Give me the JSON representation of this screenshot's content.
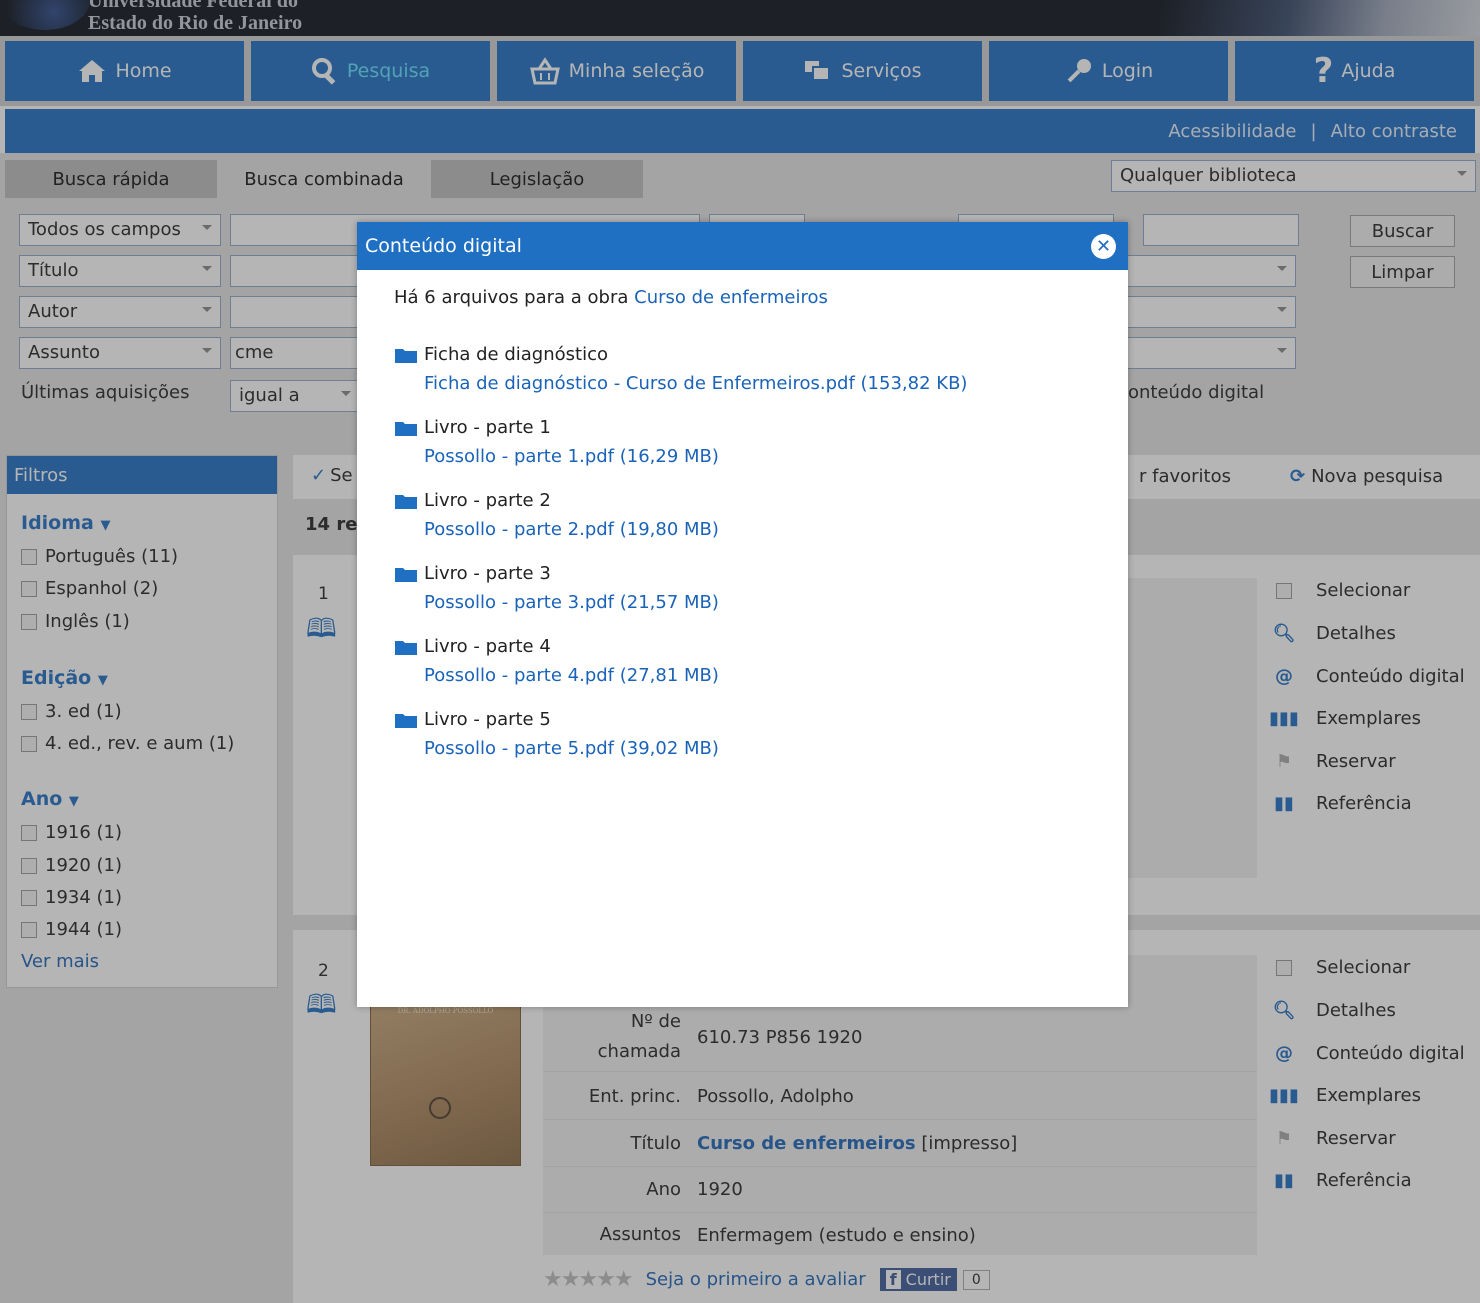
{
  "header": {
    "line1": "Universidade Federal do",
    "line2": "Estado do Rio de Janeiro"
  },
  "nav": [
    {
      "label": "Home",
      "icon": "home-icon"
    },
    {
      "label": "Pesquisa",
      "icon": "search-icon"
    },
    {
      "label": "Minha seleção",
      "icon": "basket-icon"
    },
    {
      "label": "Serviços",
      "icon": "windows-icon"
    },
    {
      "label": "Login",
      "icon": "key-icon"
    },
    {
      "label": "Ajuda",
      "icon": "help-icon"
    }
  ],
  "bluebar": {
    "accessibility": "Acessibilidade",
    "separator": "|",
    "contrast": "Alto contraste"
  },
  "tabs": [
    "Busca rápida",
    "Busca combinada",
    "Legislação"
  ],
  "library_select": "Qualquer biblioteca",
  "search": {
    "fields": [
      "Todos os campos",
      "Título",
      "Autor",
      "Assunto"
    ],
    "assunto_value": "cme",
    "last_label": "Últimas aquisições",
    "last_op": "igual a",
    "digital_label": "onteúdo digital",
    "buscar": "Buscar",
    "limpar": "Limpar"
  },
  "filters": {
    "title": "Filtros",
    "idioma": "Idioma",
    "idioma_items": [
      "Português (11)",
      "Espanhol (2)",
      "Inglês (1)"
    ],
    "edicao": "Edição",
    "edicao_items": [
      "3. ed (1)",
      "4. ed., rev. e aum (1)"
    ],
    "ano": "Ano",
    "ano_items": [
      "1916 (1)",
      "1920 (1)",
      "1934 (1)",
      "1944 (1)"
    ],
    "ver_mais": "Ver mais"
  },
  "toolbar": {
    "select_partial": "Se",
    "favoritos_partial": "r favoritos",
    "nova": "Nova pesquisa",
    "count_partial": "14 re"
  },
  "result1": {
    "num": "1"
  },
  "result2": {
    "num": "2",
    "cover_text": "DR. ADOLPHO POSSOLLO",
    "chamada_label_1": "Nº de",
    "chamada_label_2": "chamada",
    "chamada": "610.73 P856 1920",
    "ent_label": "Ent. princ.",
    "ent": "Possollo, Adolpho",
    "titulo_label": "Título",
    "titulo": "Curso de enfermeiros",
    "titulo_suffix": "[impresso]",
    "ano_label": "Ano",
    "ano": "1920",
    "assuntos_label": "Assuntos",
    "assuntos": "Enfermagem (estudo e ensino)"
  },
  "actions": [
    "Selecionar",
    "Detalhes",
    "Conteúdo digital",
    "Exemplares",
    "Reservar",
    "Referência"
  ],
  "rating": {
    "text": "Seja o primeiro a avaliar",
    "curtir": "Curtir",
    "count": "0"
  },
  "modal": {
    "title": "Conteúdo digital",
    "intro": "Há 6 arquivos para a obra",
    "work": "Curso de enfermeiros",
    "files": [
      {
        "title": "Ficha de diagnóstico",
        "link": "Ficha de diagnóstico - Curso de Enfermeiros.pdf (153,82 KB)"
      },
      {
        "title": "Livro - parte 1",
        "link": "Possollo - parte 1.pdf (16,29 MB)"
      },
      {
        "title": "Livro - parte 2",
        "link": "Possollo - parte 2.pdf (19,80 MB)"
      },
      {
        "title": "Livro - parte 3",
        "link": "Possollo - parte 3.pdf (21,57 MB)"
      },
      {
        "title": "Livro - parte 4",
        "link": "Possollo - parte 4.pdf (27,81 MB)"
      },
      {
        "title": "Livro - parte 5",
        "link": "Possollo - parte 5.pdf (39,02 MB)"
      }
    ]
  }
}
